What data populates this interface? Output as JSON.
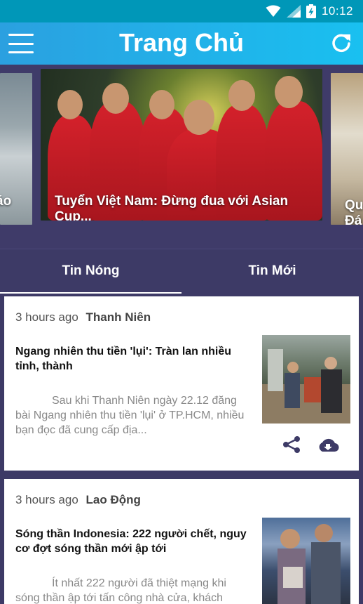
{
  "status_bar": {
    "time": "10:12"
  },
  "app_bar": {
    "title": "Trang Chủ"
  },
  "carousel": {
    "slides": [
      {
        "caption": "áo"
      },
      {
        "caption": "Tuyển Việt Nam: Đừng đua với Asian Cup..."
      },
      {
        "caption": "Qu\nĐá"
      }
    ]
  },
  "tabs": [
    {
      "label": "Tin Nóng",
      "active": true
    },
    {
      "label": "Tin Mới",
      "active": false
    }
  ],
  "feed": [
    {
      "time": "3 hours ago",
      "source": "Thanh Niên",
      "headline": "Ngang nhiên thu tiền 'lụi': Tràn lan nhiều tỉnh, thành",
      "summary": "Sau khi Thanh Niên ngày 22.12 đăng bài Ngang nhiên thu tiền 'lụi' ở TP.HCM, nhiều bạn đọc đã cung cấp địa..."
    },
    {
      "time": "3 hours ago",
      "source": "Lao Động",
      "headline": "Sóng thần Indonesia: 222 người chết, nguy cơ đợt sóng thần mới ập tới",
      "summary": "Ít nhất 222 người đã thiệt mạng khi sóng thần ập tới tấn công nhà cửa, khách"
    }
  ],
  "colors": {
    "status_bar": "#0097b8",
    "app_bar_start": "#2ba0e0",
    "app_bar_end": "#19c0f0",
    "background": "#3d3a66",
    "card": "#ffffff",
    "action_icon": "#3d3a66"
  },
  "icons": {
    "menu": "hamburger-icon",
    "refresh": "refresh-icon",
    "share": "share-icon",
    "download": "cloud-download-icon",
    "wifi": "wifi-icon",
    "signal": "signal-icon",
    "battery": "battery-charging-icon"
  }
}
